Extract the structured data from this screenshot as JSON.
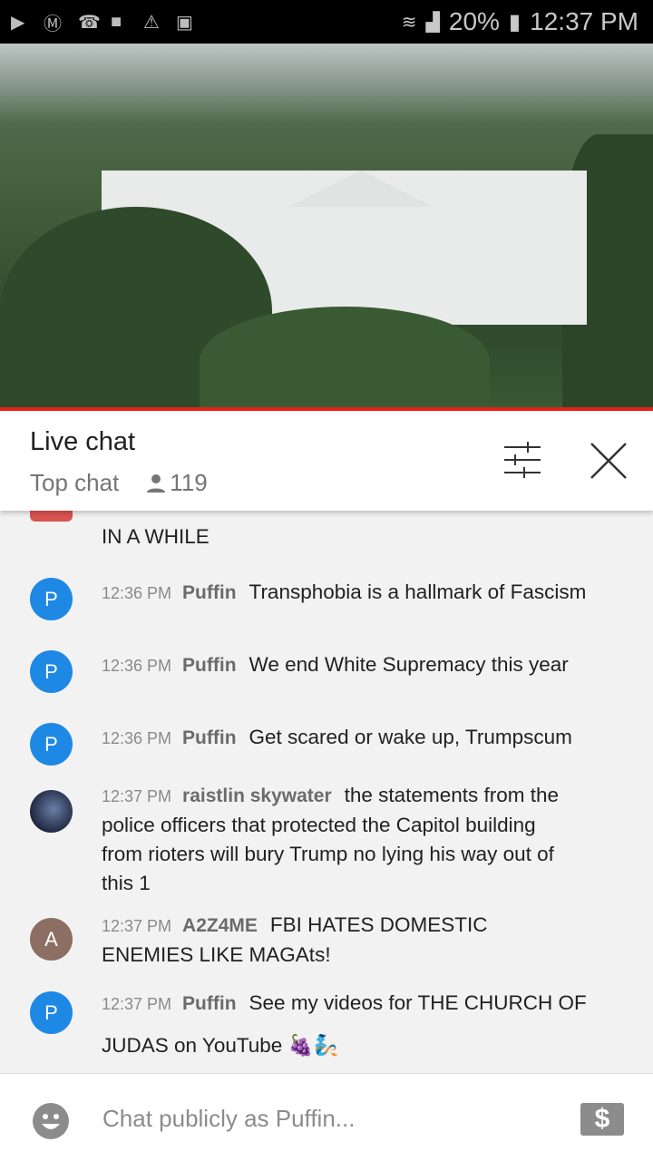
{
  "status_bar": {
    "left_icons": [
      "youtube-icon",
      "messenger-icon",
      "missed-call-icon",
      "folder-icon",
      "warning-icon",
      "image-icon"
    ],
    "battery": "20%",
    "time": "12:37 PM"
  },
  "header": {
    "title": "Live chat",
    "mode": "Top chat",
    "viewers": "119"
  },
  "messages": [
    {
      "text": "IN A WHILE",
      "avatar_color": "#d9534f"
    },
    {
      "initial": "P",
      "time": "12:36 PM",
      "author": "Puffin",
      "text": "Transphobia is a hallmark of Fascism",
      "avatar_color": "#1e88e5"
    },
    {
      "initial": "P",
      "time": "12:36 PM",
      "author": "Puffin",
      "text": "We end White Supremacy this year",
      "avatar_color": "#1e88e5"
    },
    {
      "initial": "P",
      "time": "12:36 PM",
      "author": "Puffin",
      "text": "Get scared or wake up, Trumpscum",
      "avatar_color": "#1e88e5"
    },
    {
      "time": "12:37 PM",
      "author": "raistlin skywater",
      "text": "the statements from the police officers that protected the Capitol building from rioters will bury Trump no lying his way out of this 1",
      "avatar_color": "#2a3550"
    },
    {
      "initial": "A",
      "time": "12:37 PM",
      "author": "A2Z4ME",
      "text": "FBI HATES DOMESTIC ENEMIES LIKE MAGAts!",
      "avatar_color": "#8d6e63"
    },
    {
      "initial": "P",
      "time": "12:37 PM",
      "author": "Puffin",
      "text": "See my videos for THE CHURCH OF JUDAS on YouTube 🍇🧞",
      "avatar_color": "#1e88e5"
    }
  ],
  "input": {
    "placeholder": "Chat publicly as Puffin...",
    "dollar": "$"
  },
  "colors": {
    "accent": "#e62117",
    "avatar_blue": "#1e88e5"
  }
}
